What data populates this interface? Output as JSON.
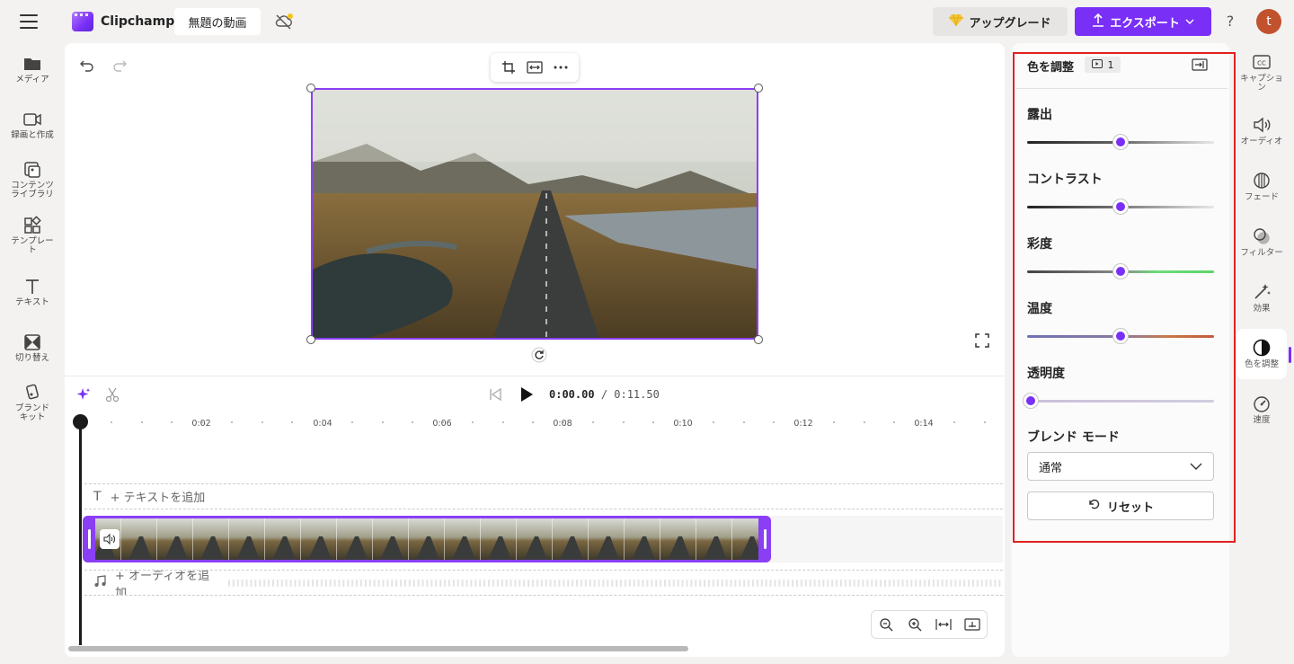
{
  "header": {
    "app_name": "Clipchamp",
    "project_title": "無題の動画",
    "upgrade_label": "アップグレード",
    "export_label": "エクスポート",
    "help_label": "?",
    "avatar_initial": "t"
  },
  "left_nav": [
    {
      "label": "メディア",
      "icon": "folder-icon"
    },
    {
      "label": "録画と作成",
      "icon": "camera-icon"
    },
    {
      "label": "コンテンツ\nライブラリ",
      "icon": "library-icon"
    },
    {
      "label": "テンプレー\nト",
      "icon": "templates-icon"
    },
    {
      "label": "テキスト",
      "icon": "text-icon"
    },
    {
      "label": "切り替え",
      "icon": "transition-icon"
    },
    {
      "label": "ブランド\nキット",
      "icon": "brand-kit-icon"
    }
  ],
  "timeline": {
    "current_time": "0:00.00",
    "total_time": "/ 0:11.50",
    "ruler": [
      "0:02",
      "0:04",
      "0:06",
      "0:08",
      "0:10",
      "0:12",
      "0:14"
    ],
    "add_text": "+ テキストを追加",
    "add_audio": "+ オーディオを追加"
  },
  "panel": {
    "title": "色を調整",
    "clip_count": "1",
    "sliders": [
      {
        "label": "露出",
        "value": 0.5
      },
      {
        "label": "コントラスト",
        "value": 0.5
      },
      {
        "label": "彩度",
        "value": 0.5
      },
      {
        "label": "温度",
        "value": 0.5
      },
      {
        "label": "透明度",
        "value": 0.0
      }
    ],
    "blend_label": "ブレンド モード",
    "blend_value": "通常",
    "reset_label": "リセット"
  },
  "right_nav": [
    {
      "label": "キャプショ\nン",
      "icon": "captions-icon"
    },
    {
      "label": "オーディオ",
      "icon": "audio-icon"
    },
    {
      "label": "フェード",
      "icon": "fade-icon"
    },
    {
      "label": "フィルター",
      "icon": "filter-icon"
    },
    {
      "label": "効果",
      "icon": "effects-icon"
    },
    {
      "label": "色を調整",
      "icon": "adjust-colors-icon",
      "active": true
    },
    {
      "label": "速度",
      "icon": "speed-icon"
    }
  ],
  "colors": {
    "accent": "#7a2ff7",
    "highlight_box": "#e02020"
  }
}
